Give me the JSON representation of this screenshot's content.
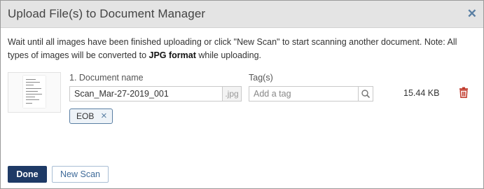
{
  "dialog": {
    "title": "Upload File(s) to Document Manager",
    "close_icon": "close-icon"
  },
  "notice": {
    "text_part1": "Wait until all images have been finished uploading or click \"New Scan\" to start scanning another document. Note: All types of images will be converted to ",
    "bold": "JPG format",
    "text_part2": " while uploading."
  },
  "file": {
    "doc_name_label": "1. Document name",
    "doc_name_value": "Scan_Mar-27-2019_001",
    "extension": ".jpg",
    "tags_label": "Tag(s)",
    "tag_placeholder": "Add a tag",
    "size": "15.44 KB",
    "tags": [
      "EOB"
    ],
    "tag_remove_icon": "close-icon",
    "search_icon": "search-icon",
    "delete_icon": "trash-icon"
  },
  "footer": {
    "done_label": "Done",
    "new_scan_label": "New Scan"
  },
  "colors": {
    "titlebar": "#e4e4e4",
    "primary_button": "#1e3a66",
    "accent": "#5a7fa3",
    "danger": "#c0392b"
  }
}
